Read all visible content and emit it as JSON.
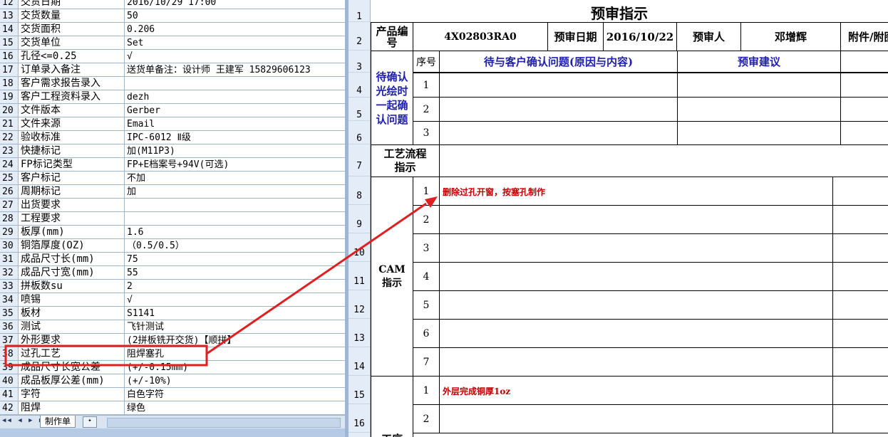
{
  "left_sheet": {
    "rows": [
      {
        "n": "12",
        "a": "交货日期",
        "b": "2016/10/29 17:00"
      },
      {
        "n": "13",
        "a": "交货数量",
        "b": "50"
      },
      {
        "n": "14",
        "a": "交货面积",
        "b": "0.206"
      },
      {
        "n": "15",
        "a": "交货单位",
        "b": "Set"
      },
      {
        "n": "16",
        "a": "孔径<=0.25",
        "b": "√"
      },
      {
        "n": "17",
        "a": "订单录入备注",
        "b": "送货单备注：设计师 王建军 15829606123"
      },
      {
        "n": "18",
        "a": "客户需求报告录入",
        "b": ""
      },
      {
        "n": "19",
        "a": "客户工程资料录入",
        "b": "dezh"
      },
      {
        "n": "20",
        "a": "文件版本",
        "b": "Gerber"
      },
      {
        "n": "21",
        "a": "文件来源",
        "b": "Email"
      },
      {
        "n": "22",
        "a": "验收标准",
        "b": "IPC-6012 Ⅱ级"
      },
      {
        "n": "23",
        "a": "快捷标记",
        "b": "加(M11P3)"
      },
      {
        "n": "24",
        "a": "FP标记类型",
        "b": "FP+E档案号+94V(可选)"
      },
      {
        "n": "25",
        "a": "客户标记",
        "b": "不加"
      },
      {
        "n": "26",
        "a": "周期标记",
        "b": "加"
      },
      {
        "n": "27",
        "a": "出货要求",
        "b": ""
      },
      {
        "n": "28",
        "a": "工程要求",
        "b": ""
      },
      {
        "n": "29",
        "a": "板厚(mm)",
        "b": "1.6"
      },
      {
        "n": "30",
        "a": "铜箔厚度(OZ)",
        "b": "（0.5/0.5）"
      },
      {
        "n": "31",
        "a": "成品尺寸长(mm)",
        "b": "75"
      },
      {
        "n": "32",
        "a": "成品尺寸宽(mm)",
        "b": "55"
      },
      {
        "n": "33",
        "a": "拼板数su",
        "b": "2"
      },
      {
        "n": "34",
        "a": "喷锡",
        "b": "√"
      },
      {
        "n": "35",
        "a": "板材",
        "b": "S1141"
      },
      {
        "n": "36",
        "a": "测试",
        "b": "飞针测试"
      },
      {
        "n": "37",
        "a": "外形要求",
        "b": "(2拼板铣开交货)【顺拼】"
      },
      {
        "n": "38",
        "a": "过孔工艺",
        "b": "阻焊塞孔"
      },
      {
        "n": "39",
        "a": "成品尺寸长宽公差",
        "b": "(+/-0.15mm)"
      },
      {
        "n": "40",
        "a": "成品板厚公差(mm)",
        "b": "(+/-10%)"
      },
      {
        "n": "41",
        "a": "字符",
        "b": "白色字符"
      },
      {
        "n": "42",
        "a": "阻焊",
        "b": "绿色"
      }
    ],
    "sheet_tab": "制作单",
    "nav_buttons": "◀◀ ◀ ▶ ▶▶"
  },
  "right_sheet": {
    "row_headers": [
      "1",
      "2",
      "3",
      "4",
      "5",
      "6",
      "7",
      "8",
      "9",
      "10",
      "11",
      "12",
      "13",
      "14",
      "15",
      "16"
    ],
    "title": "预审指示",
    "product_no_label": "产品编号",
    "product_no": "4X02803RA0",
    "review_date_label": "预审日期",
    "review_date": "2016/10/22",
    "reviewer_label": "预审人",
    "reviewer": "邓增辉",
    "attachment_label": "附件/附图",
    "seq_label": "序号",
    "pending_label": "待与客户确认问题(原因与内容)",
    "suggestion_label": "预审建议",
    "confirm_section_label": "待确认光绘时一起确认问题",
    "confirm_numbers": [
      "1",
      "2",
      "3"
    ],
    "process_flow_label": "工艺流程指示",
    "cam_label": "CAM指示",
    "cam_numbers": [
      "1",
      "2",
      "3",
      "4",
      "5",
      "6",
      "7"
    ],
    "cam_item1": "删除过孔开窗，按塞孔制作",
    "process_numbers": [
      "1",
      "2"
    ],
    "process_item1": "外层完成铜厚1oz",
    "process_label_partial": "工序"
  },
  "colors": {
    "annotation_red": "#e02020",
    "header_blue": "#2020b0",
    "grid": "#9eb6ce"
  }
}
